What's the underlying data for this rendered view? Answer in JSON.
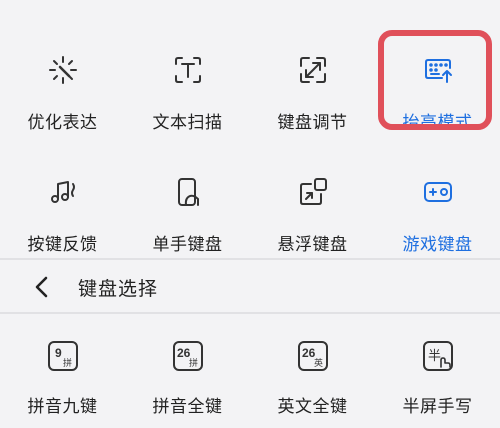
{
  "row1": [
    {
      "label": "优化表达",
      "icon": "sparkle-wand-icon"
    },
    {
      "label": "文本扫描",
      "icon": "text-scan-icon"
    },
    {
      "label": "键盘调节",
      "icon": "resize-icon"
    },
    {
      "label": "抬高模式",
      "icon": "keyboard-raise-icon",
      "active": true
    }
  ],
  "row2": [
    {
      "label": "按键反馈",
      "icon": "music-vibrate-icon"
    },
    {
      "label": "单手键盘",
      "icon": "one-hand-keyboard-icon"
    },
    {
      "label": "悬浮键盘",
      "icon": "floating-keyboard-icon"
    },
    {
      "label": "游戏键盘",
      "icon": "gamepad-icon",
      "active": true
    }
  ],
  "section": {
    "title": "键盘选择"
  },
  "row3": [
    {
      "label": "拼音九键",
      "icon": "pinyin-9-key-icon",
      "badge_num": "9",
      "badge_sub": "拼"
    },
    {
      "label": "拼音全键",
      "icon": "pinyin-26-key-icon",
      "badge_num": "26",
      "badge_sub": "拼"
    },
    {
      "label": "英文全键",
      "icon": "english-26-key-icon",
      "badge_num": "26",
      "badge_sub": "英"
    },
    {
      "label": "半屏手写",
      "icon": "half-screen-handwriting-icon",
      "badge_num": "半",
      "badge_sub": ""
    }
  ],
  "colors": {
    "accent": "#1e6fe0",
    "highlight": "#e0505a",
    "text": "#222222",
    "background": "#f3f3f5"
  }
}
